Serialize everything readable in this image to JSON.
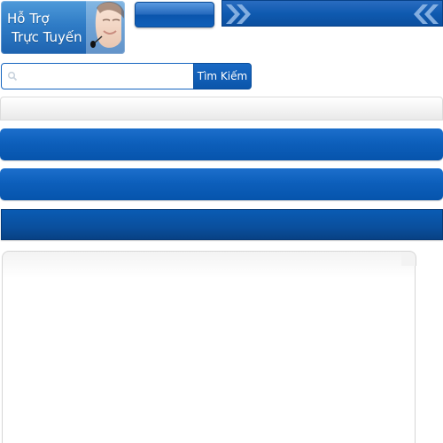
{
  "support": {
    "line1": "Hỗ Trợ",
    "line2": "Trực Tuyến"
  },
  "search": {
    "placeholder": "",
    "value": "",
    "button_label": "Tìm Kiếm"
  },
  "colors": {
    "primary_blue": "#0d5fbb",
    "dark_blue": "#084184",
    "light_gray": "#f2f2f2"
  },
  "icons": [
    "search-icon",
    "chevron-right-icon",
    "chevron-left-icon",
    "operator-headset-icon"
  ]
}
